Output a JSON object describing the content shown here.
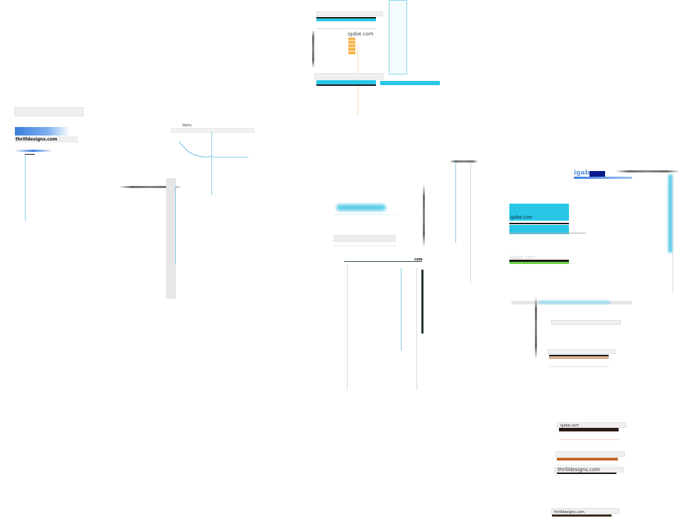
{
  "fragments": {
    "left_panel": {
      "domain_label": "thrilldesigns.com"
    },
    "left_mid_panel": {
      "tab_label": "Vartu"
    },
    "top_center": {
      "domain_label": "igabe.com"
    },
    "center_panel": {
      "suffix_label": "com"
    },
    "right_panel": {
      "header_label": "igabe",
      "cyan_box_label": "igabe.com",
      "faded_label": "igabe.com"
    },
    "bottom_right": {
      "label_one": "igabe.com",
      "label_two": "thrilldesigns.com",
      "label_three": "thrilldesigns.com"
    }
  },
  "colors": {
    "accent_cyan": "#29c6e6",
    "accent_blue": "#3b7ddd",
    "navy": "#0b1a8a",
    "orange": "#f5b34a",
    "rust": "#c8632a",
    "green": "#6ad04a"
  }
}
